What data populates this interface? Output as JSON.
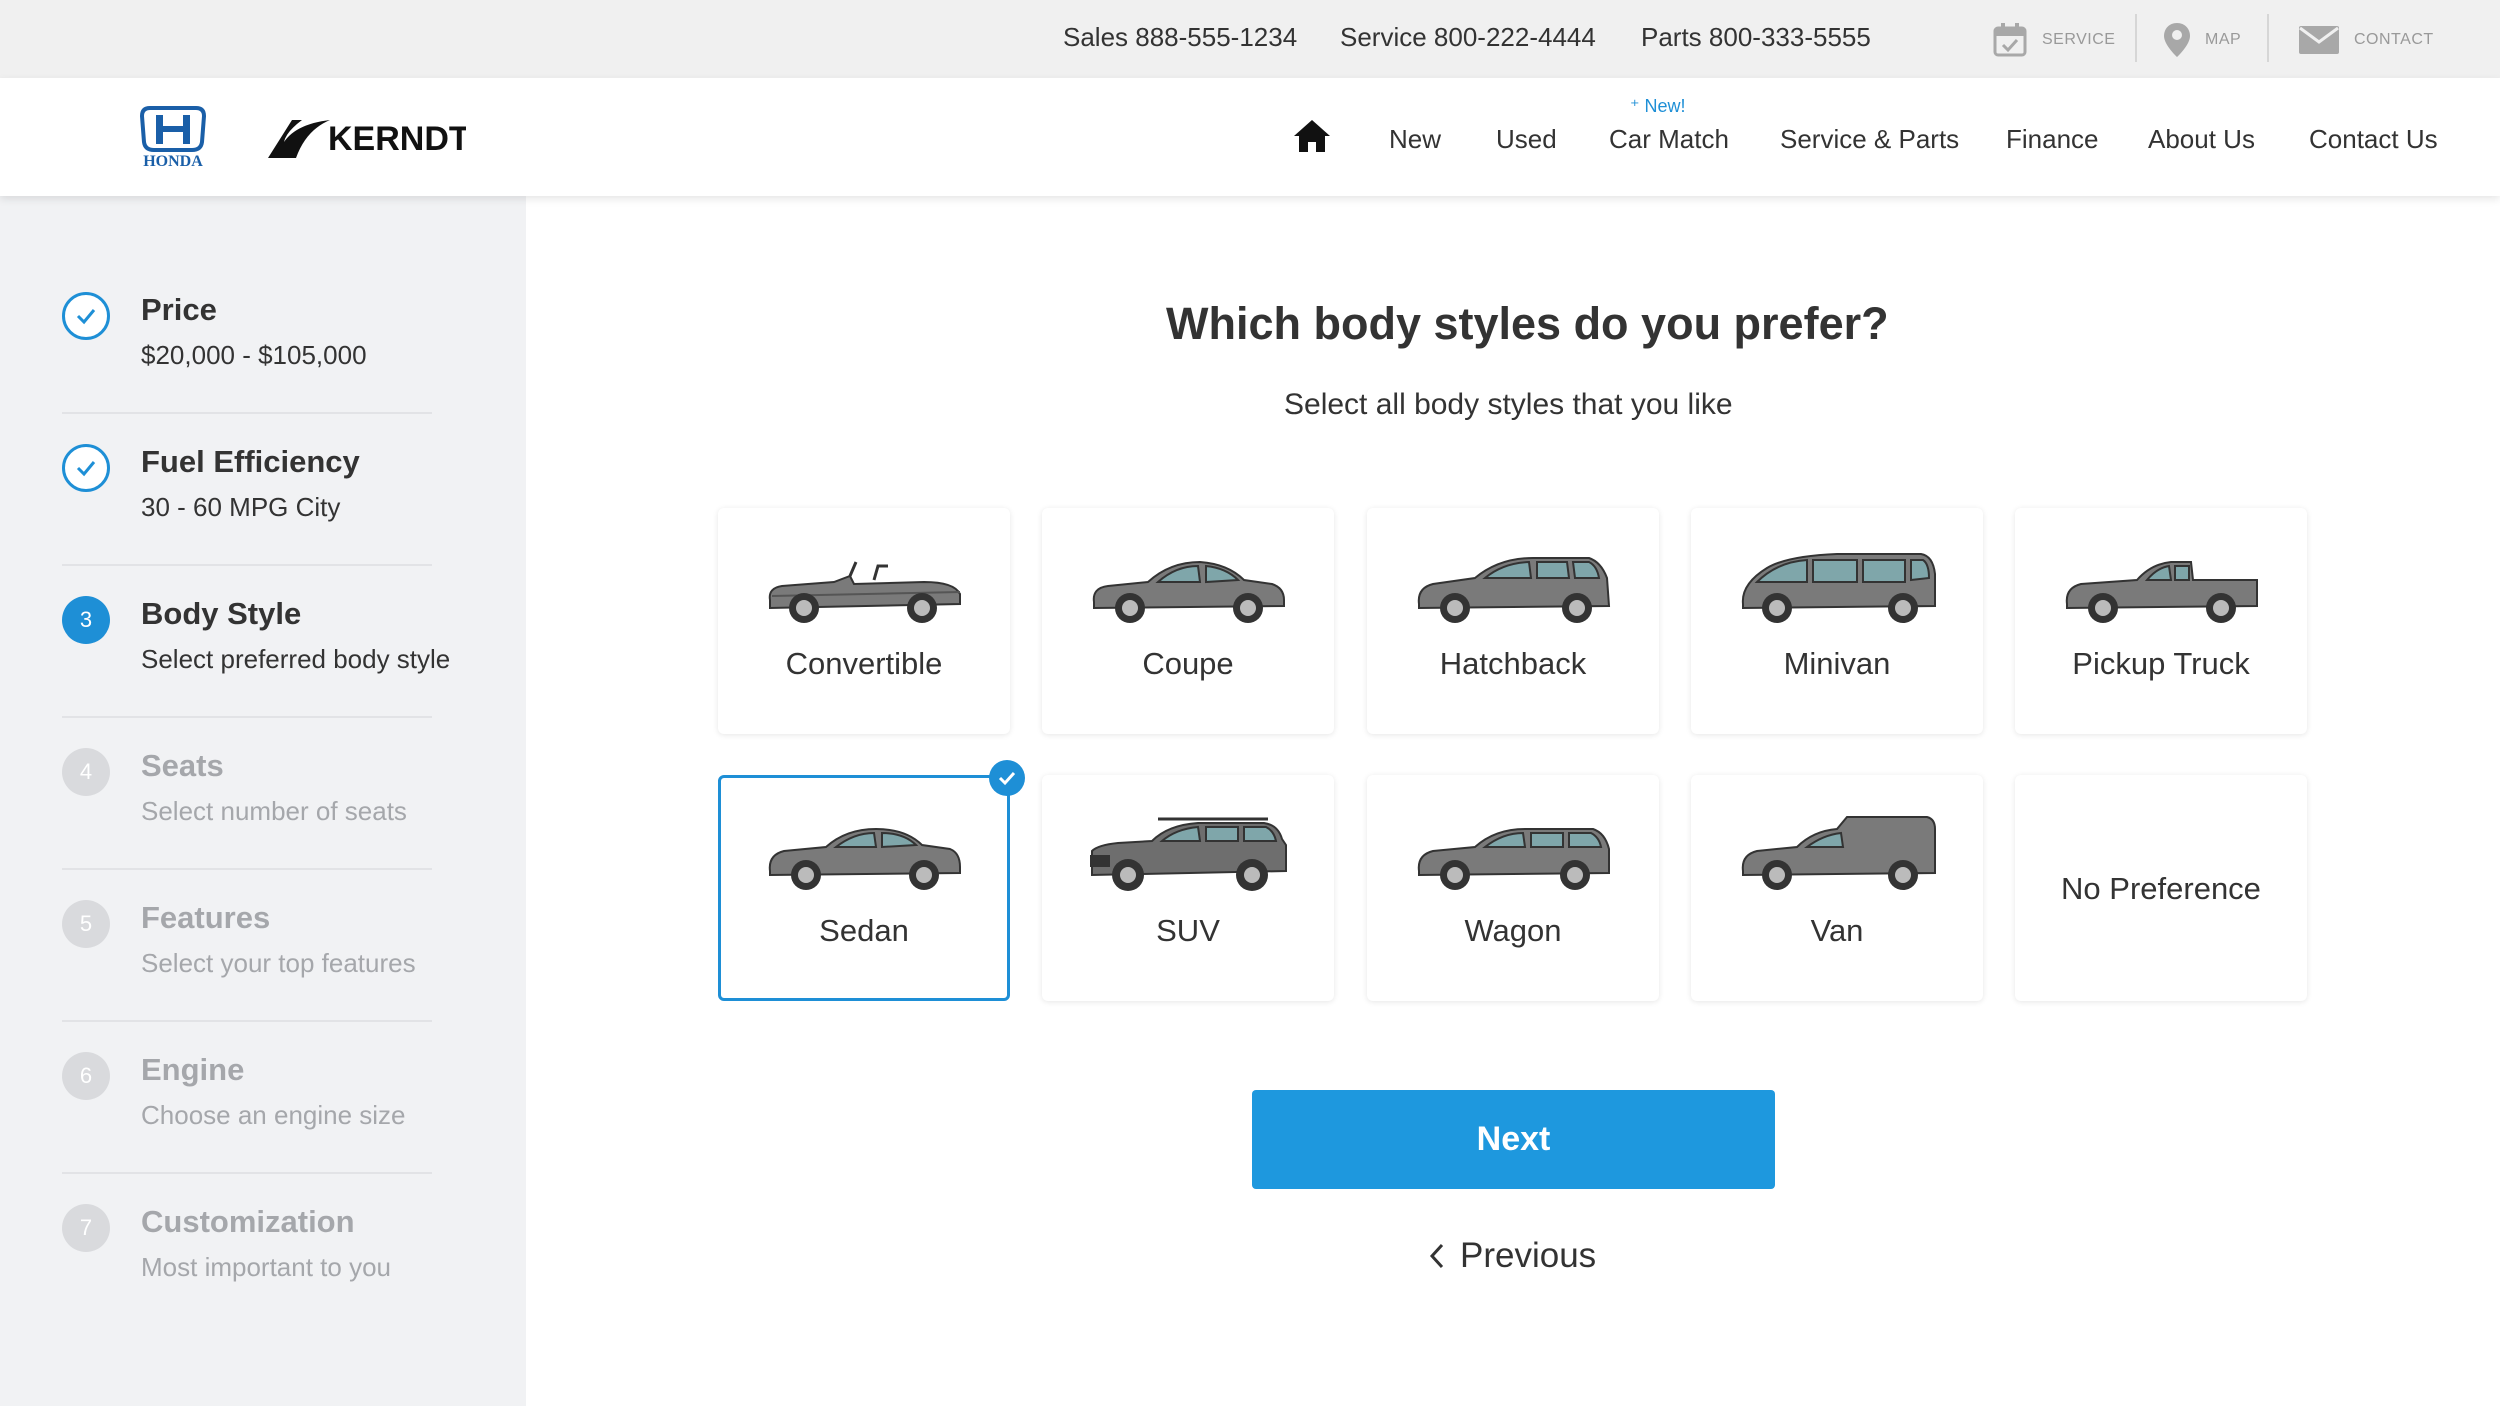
{
  "utility": {
    "sales": "Sales 888-555-1234",
    "service": "Service 800-222-4444",
    "parts": "Parts 800-333-5555",
    "links": [
      {
        "label": "SERVICE",
        "icon": "calendar-icon"
      },
      {
        "label": "MAP",
        "icon": "map-pin-icon"
      },
      {
        "label": "CONTACT",
        "icon": "envelope-icon"
      }
    ]
  },
  "header": {
    "honda_logo_text": "HONDA",
    "dealer_logo_text": "KERNDT",
    "home_icon": "home-icon",
    "nav": [
      "New",
      "Used",
      "Car Match",
      "Service & Parts",
      "Finance",
      "About Us",
      "Contact Us"
    ],
    "new_badge": "New!"
  },
  "steps": [
    {
      "number": "1",
      "title": "Price",
      "subtitle": "$20,000 - $105,000",
      "status": "done"
    },
    {
      "number": "2",
      "title": "Fuel Efficiency",
      "subtitle": "30 - 60 MPG City",
      "status": "done"
    },
    {
      "number": "3",
      "title": "Body Style",
      "subtitle": "Select preferred body style",
      "status": "active"
    },
    {
      "number": "4",
      "title": "Seats",
      "subtitle": "Select number of seats",
      "status": "pending"
    },
    {
      "number": "5",
      "title": "Features",
      "subtitle": "Select your top features",
      "status": "pending"
    },
    {
      "number": "6",
      "title": "Engine",
      "subtitle": "Choose an engine size",
      "status": "pending"
    },
    {
      "number": "7",
      "title": "Customization",
      "subtitle": "Most important to you",
      "status": "pending"
    }
  ],
  "main": {
    "title": "Which body styles do you prefer?",
    "subtitle": "Select all body styles that you like",
    "options": [
      {
        "label": "Convertible",
        "selected": false
      },
      {
        "label": "Coupe",
        "selected": false
      },
      {
        "label": "Hatchback",
        "selected": false
      },
      {
        "label": "Minivan",
        "selected": false
      },
      {
        "label": "Pickup Truck",
        "selected": false
      },
      {
        "label": "Sedan",
        "selected": true
      },
      {
        "label": "SUV",
        "selected": false
      },
      {
        "label": "Wagon",
        "selected": false
      },
      {
        "label": "Van",
        "selected": false
      },
      {
        "label": "No Preference",
        "selected": false
      }
    ],
    "next_label": "Next",
    "previous_label": "Previous"
  },
  "colors": {
    "accent": "#1e98de",
    "sidebar_bg": "#f1f2f4",
    "car_body": "#7a7a7a",
    "car_window": "#7fa6aa"
  }
}
